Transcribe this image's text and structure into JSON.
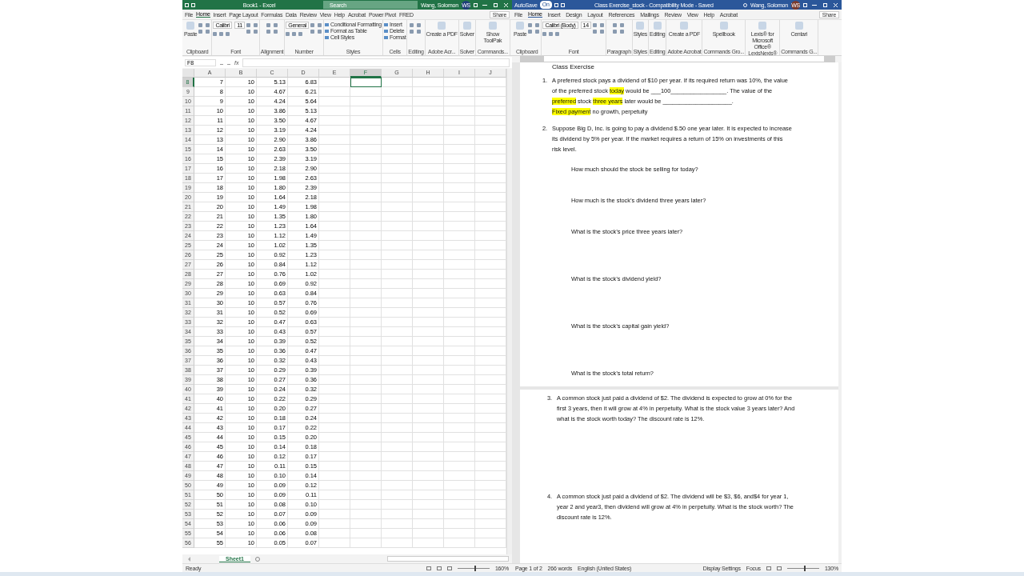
{
  "excel": {
    "title": "Book1 - Excel",
    "search": "Search",
    "user": "Wang, Solomon",
    "initials": "WS",
    "tabs": [
      {
        "label": "File",
        "selected": false
      },
      {
        "label": "Home",
        "selected": true
      },
      {
        "label": "Insert",
        "selected": false
      },
      {
        "label": "Page Layout",
        "selected": false
      },
      {
        "label": "Formulas",
        "selected": false
      },
      {
        "label": "Data",
        "selected": false
      },
      {
        "label": "Review",
        "selected": false
      },
      {
        "label": "View",
        "selected": false
      },
      {
        "label": "Help",
        "selected": false
      },
      {
        "label": "Acrobat",
        "selected": false
      },
      {
        "label": "Power Pivot",
        "selected": false
      },
      {
        "label": "FRED",
        "selected": false
      }
    ],
    "share": "Share",
    "groups": [
      {
        "label": "Clipboard",
        "controls": [
          {
            "kind": "big",
            "label": "Paste"
          },
          {
            "kind": "icons"
          }
        ]
      },
      {
        "label": "Font",
        "controls": [
          {
            "kind": "fields",
            "values": [
              "Calibri",
              "11"
            ]
          },
          {
            "kind": "icons"
          }
        ]
      },
      {
        "label": "Alignment",
        "controls": [
          {
            "kind": "icons"
          }
        ]
      },
      {
        "label": "Number",
        "controls": [
          {
            "kind": "fields",
            "values": [
              "General"
            ]
          },
          {
            "kind": "icons"
          }
        ]
      },
      {
        "label": "Styles",
        "controls": [
          {
            "kind": "list",
            "labels": [
              "Conditional Formatting",
              "Format as Table",
              "Cell Styles"
            ]
          }
        ]
      },
      {
        "label": "Cells",
        "controls": [
          {
            "kind": "list",
            "labels": [
              "Insert",
              "Delete",
              "Format"
            ]
          }
        ]
      },
      {
        "label": "Editing",
        "controls": [
          {
            "kind": "icons"
          }
        ]
      },
      {
        "label": "Adobe Acr...",
        "controls": [
          {
            "kind": "big",
            "label": "Create a PDF"
          }
        ]
      },
      {
        "label": "Solver",
        "controls": [
          {
            "kind": "big",
            "label": "Solver"
          }
        ]
      },
      {
        "label": "Commands...",
        "controls": [
          {
            "kind": "big",
            "label": "Show ToolPak"
          }
        ]
      }
    ],
    "name_box": "F8",
    "fx": "fx",
    "columns": [
      {
        "label": "A",
        "selected": false
      },
      {
        "label": "B",
        "selected": false
      },
      {
        "label": "C",
        "selected": false
      },
      {
        "label": "D",
        "selected": false
      },
      {
        "label": "E",
        "selected": false
      },
      {
        "label": "F",
        "selected": true
      },
      {
        "label": "G",
        "selected": false
      },
      {
        "label": "H",
        "selected": false
      },
      {
        "label": "I",
        "selected": false
      },
      {
        "label": "J",
        "selected": false
      }
    ],
    "rows": [
      {
        "num": "8",
        "selected": true,
        "cells": [
          "7",
          "10",
          "5.13",
          "6.83"
        ]
      },
      {
        "num": "9",
        "selected": false,
        "cells": [
          "8",
          "10",
          "4.67",
          "6.21"
        ]
      },
      {
        "num": "10",
        "selected": false,
        "cells": [
          "9",
          "10",
          "4.24",
          "5.64"
        ]
      },
      {
        "num": "11",
        "selected": false,
        "cells": [
          "10",
          "10",
          "3.86",
          "5.13"
        ]
      },
      {
        "num": "12",
        "selected": false,
        "cells": [
          "11",
          "10",
          "3.50",
          "4.67"
        ]
      },
      {
        "num": "13",
        "selected": false,
        "cells": [
          "12",
          "10",
          "3.19",
          "4.24"
        ]
      },
      {
        "num": "14",
        "selected": false,
        "cells": [
          "13",
          "10",
          "2.90",
          "3.86"
        ]
      },
      {
        "num": "15",
        "selected": false,
        "cells": [
          "14",
          "10",
          "2.63",
          "3.50"
        ]
      },
      {
        "num": "16",
        "selected": false,
        "cells": [
          "15",
          "10",
          "2.39",
          "3.19"
        ]
      },
      {
        "num": "17",
        "selected": false,
        "cells": [
          "16",
          "10",
          "2.18",
          "2.90"
        ]
      },
      {
        "num": "18",
        "selected": false,
        "cells": [
          "17",
          "10",
          "1.98",
          "2.63"
        ]
      },
      {
        "num": "19",
        "selected": false,
        "cells": [
          "18",
          "10",
          "1.80",
          "2.39"
        ]
      },
      {
        "num": "20",
        "selected": false,
        "cells": [
          "19",
          "10",
          "1.64",
          "2.18"
        ]
      },
      {
        "num": "21",
        "selected": false,
        "cells": [
          "20",
          "10",
          "1.49",
          "1.98"
        ]
      },
      {
        "num": "22",
        "selected": false,
        "cells": [
          "21",
          "10",
          "1.35",
          "1.80"
        ]
      },
      {
        "num": "23",
        "selected": false,
        "cells": [
          "22",
          "10",
          "1.23",
          "1.64"
        ]
      },
      {
        "num": "24",
        "selected": false,
        "cells": [
          "23",
          "10",
          "1.12",
          "1.49"
        ]
      },
      {
        "num": "25",
        "selected": false,
        "cells": [
          "24",
          "10",
          "1.02",
          "1.35"
        ]
      },
      {
        "num": "26",
        "selected": false,
        "cells": [
          "25",
          "10",
          "0.92",
          "1.23"
        ]
      },
      {
        "num": "27",
        "selected": false,
        "cells": [
          "26",
          "10",
          "0.84",
          "1.12"
        ]
      },
      {
        "num": "28",
        "selected": false,
        "cells": [
          "27",
          "10",
          "0.76",
          "1.02"
        ]
      },
      {
        "num": "29",
        "selected": false,
        "cells": [
          "28",
          "10",
          "0.69",
          "0.92"
        ]
      },
      {
        "num": "30",
        "selected": false,
        "cells": [
          "29",
          "10",
          "0.63",
          "0.84"
        ]
      },
      {
        "num": "31",
        "selected": false,
        "cells": [
          "30",
          "10",
          "0.57",
          "0.76"
        ]
      },
      {
        "num": "32",
        "selected": false,
        "cells": [
          "31",
          "10",
          "0.52",
          "0.69"
        ]
      },
      {
        "num": "33",
        "selected": false,
        "cells": [
          "32",
          "10",
          "0.47",
          "0.63"
        ]
      },
      {
        "num": "34",
        "selected": false,
        "cells": [
          "33",
          "10",
          "0.43",
          "0.57"
        ]
      },
      {
        "num": "35",
        "selected": false,
        "cells": [
          "34",
          "10",
          "0.39",
          "0.52"
        ]
      },
      {
        "num": "36",
        "selected": false,
        "cells": [
          "35",
          "10",
          "0.36",
          "0.47"
        ]
      },
      {
        "num": "37",
        "selected": false,
        "cells": [
          "36",
          "10",
          "0.32",
          "0.43"
        ]
      },
      {
        "num": "38",
        "selected": false,
        "cells": [
          "37",
          "10",
          "0.29",
          "0.39"
        ]
      },
      {
        "num": "39",
        "selected": false,
        "cells": [
          "38",
          "10",
          "0.27",
          "0.36"
        ]
      },
      {
        "num": "40",
        "selected": false,
        "cells": [
          "39",
          "10",
          "0.24",
          "0.32"
        ]
      },
      {
        "num": "41",
        "selected": false,
        "cells": [
          "40",
          "10",
          "0.22",
          "0.29"
        ]
      },
      {
        "num": "42",
        "selected": false,
        "cells": [
          "41",
          "10",
          "0.20",
          "0.27"
        ]
      },
      {
        "num": "43",
        "selected": false,
        "cells": [
          "42",
          "10",
          "0.18",
          "0.24"
        ]
      },
      {
        "num": "44",
        "selected": false,
        "cells": [
          "43",
          "10",
          "0.17",
          "0.22"
        ]
      },
      {
        "num": "45",
        "selected": false,
        "cells": [
          "44",
          "10",
          "0.15",
          "0.20"
        ]
      },
      {
        "num": "46",
        "selected": false,
        "cells": [
          "45",
          "10",
          "0.14",
          "0.18"
        ]
      },
      {
        "num": "47",
        "selected": false,
        "cells": [
          "46",
          "10",
          "0.12",
          "0.17"
        ]
      },
      {
        "num": "48",
        "selected": false,
        "cells": [
          "47",
          "10",
          "0.11",
          "0.15"
        ]
      },
      {
        "num": "49",
        "selected": false,
        "cells": [
          "48",
          "10",
          "0.10",
          "0.14"
        ]
      },
      {
        "num": "50",
        "selected": false,
        "cells": [
          "49",
          "10",
          "0.09",
          "0.12"
        ]
      },
      {
        "num": "51",
        "selected": false,
        "cells": [
          "50",
          "10",
          "0.09",
          "0.11"
        ]
      },
      {
        "num": "52",
        "selected": false,
        "cells": [
          "51",
          "10",
          "0.08",
          "0.10"
        ]
      },
      {
        "num": "53",
        "selected": false,
        "cells": [
          "52",
          "10",
          "0.07",
          "0.09"
        ]
      },
      {
        "num": "54",
        "selected": false,
        "cells": [
          "53",
          "10",
          "0.06",
          "0.09"
        ]
      },
      {
        "num": "55",
        "selected": false,
        "cells": [
          "54",
          "10",
          "0.06",
          "0.08"
        ]
      },
      {
        "num": "56",
        "selected": false,
        "cells": [
          "55",
          "10",
          "0.05",
          "0.07"
        ]
      }
    ],
    "sheets": [
      {
        "label": "Sheet1",
        "selected": true
      }
    ],
    "status": "Ready",
    "zoom_slider": {
      "level": 0.55
    },
    "zoom": "160%"
  },
  "word": {
    "autosave": {
      "label": "AutoSave",
      "on": true,
      "text": "On"
    },
    "title": "Class Exercise_stock  -  Compatibility Mode  -  Saved",
    "user": "Wang, Solomon",
    "initials": "WS",
    "tabs": [
      {
        "label": "File",
        "selected": false
      },
      {
        "label": "Home",
        "selected": true
      },
      {
        "label": "Insert",
        "selected": false
      },
      {
        "label": "Design",
        "selected": false
      },
      {
        "label": "Layout",
        "selected": false
      },
      {
        "label": "References",
        "selected": false
      },
      {
        "label": "Mailings",
        "selected": false
      },
      {
        "label": "Review",
        "selected": false
      },
      {
        "label": "View",
        "selected": false
      },
      {
        "label": "Help",
        "selected": false
      },
      {
        "label": "Acrobat",
        "selected": false
      }
    ],
    "share": "Share",
    "groups": [
      {
        "label": "Clipboard",
        "controls": [
          {
            "kind": "big",
            "label": "Paste"
          },
          {
            "kind": "icons"
          }
        ]
      },
      {
        "label": "Font",
        "controls": [
          {
            "kind": "fields",
            "values": [
              "Calibri (Body)",
              "14"
            ]
          },
          {
            "kind": "icons"
          }
        ]
      },
      {
        "label": "Paragraph",
        "controls": [
          {
            "kind": "icons"
          }
        ]
      },
      {
        "label": "Styles",
        "controls": [
          {
            "kind": "big",
            "label": "Styles"
          }
        ]
      },
      {
        "label": "Editing",
        "controls": [
          {
            "kind": "big",
            "label": "Editing"
          }
        ]
      },
      {
        "label": "Adobe Acrobat",
        "controls": [
          {
            "kind": "big",
            "label": "Create a PDF"
          }
        ]
      },
      {
        "label": "Commands Gro...",
        "controls": [
          {
            "kind": "big",
            "label": "Spellbook"
          }
        ]
      },
      {
        "label": "LexisNexis®",
        "controls": [
          {
            "kind": "big",
            "label": "Lexis® for Microsoft Office®"
          }
        ]
      },
      {
        "label": "Commands G...",
        "controls": [
          {
            "kind": "big",
            "label": "Centari"
          }
        ]
      }
    ],
    "heading": "Class Exercise",
    "pages": [
      {
        "items": [
          {
            "number": "1.",
            "segments": [
              {
                "text": "A preferred stock pays a dividend of $10 per year. If its required return was 10%, the value of the preferred stock ",
                "highlight": false
              },
              {
                "text": "today",
                "highlight": true
              },
              {
                "text": " would be ___100_________________. The value of the ",
                "highlight": false
              },
              {
                "text": "preferred",
                "highlight": true
              },
              {
                "text": " stock ",
                "highlight": false
              },
              {
                "text": "three years",
                "highlight": true
              },
              {
                "text": " later would be _____________________.",
                "highlight": false
              }
            ],
            "note": [
              {
                "text": "Fixed payment",
                "highlight": true
              },
              {
                "text": " no growth, perpetuity",
                "highlight": false
              }
            ]
          },
          {
            "number": "2.",
            "segments": [
              {
                "text": "Suppose Big D, Inc. is going to pay a dividend $.50 one year later. It is expected to increase its dividend by 5% per year. If the market requires a return of 15% on investments of this risk level.",
                "highlight": false
              }
            ],
            "questions": [
              "How much should the stock be selling for today?",
              "How much is the stock’s dividend three years later?",
              "What is the stock’s price three years later?",
              "What is the stock’s dividend yield?",
              "What is the stock’s capital gain yield?",
              "What is the stock’s total return?"
            ]
          }
        ]
      },
      {
        "items": [
          {
            "number": "3.",
            "segments": [
              {
                "text": "A common stock just paid a dividend of $2. The dividend is expected to grow at 0% for the first 3 years, then it will grow at 4% in perpetuity. What is the stock value 3 years later? And what is the stock worth today? The discount rate is 12%.",
                "highlight": false
              }
            ]
          },
          {
            "number": "4.",
            "segments": [
              {
                "text": "A common stock just paid a dividend of $2. The dividend will be $3, $6, and$4 for year 1, year 2 and year3, then dividend will grow at 4% in perpetuity. What is the stock worth? The discount rate is 12%.",
                "highlight": false
              }
            ]
          }
        ]
      }
    ],
    "status": [
      "Page 1 of 2",
      "266 words",
      "English (United States)"
    ],
    "status_right": [
      "Display Settings",
      "Focus"
    ],
    "zoom_slider": {
      "level": 0.55
    },
    "zoom": "130%"
  }
}
